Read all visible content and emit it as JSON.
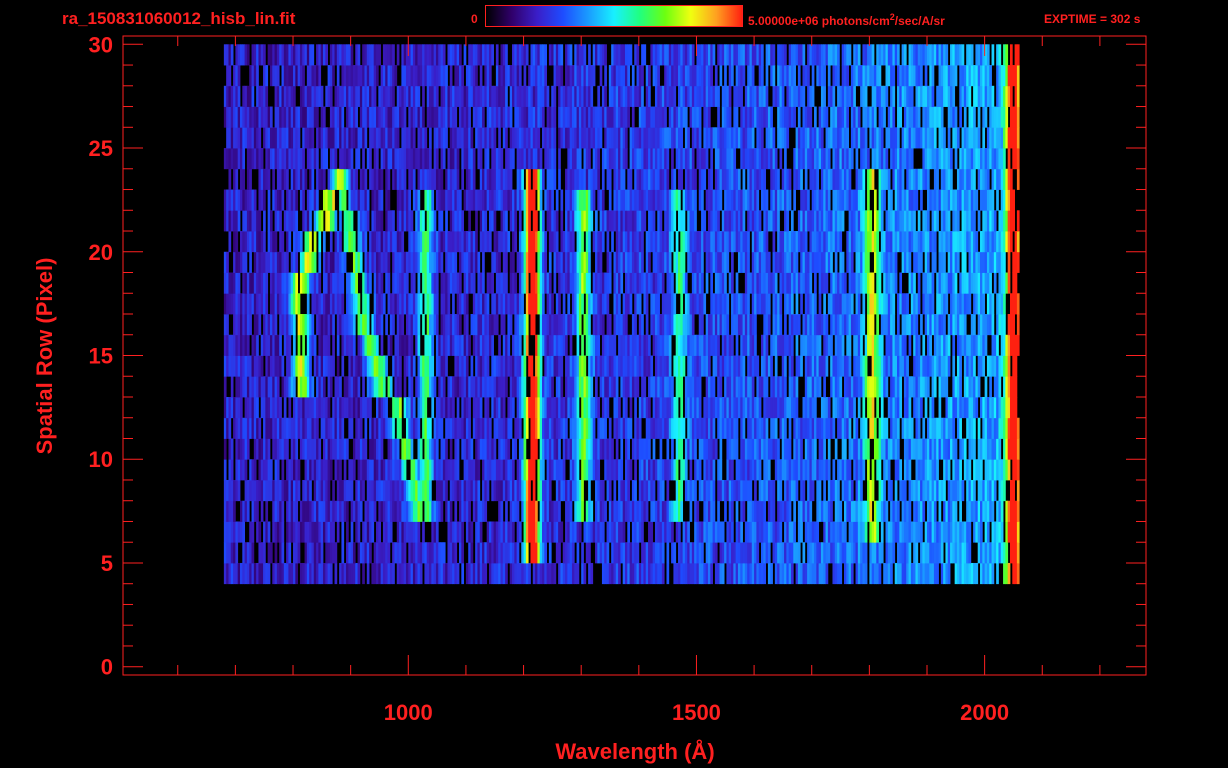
{
  "header": {
    "title": "ra_150831060012_hisb_lin.fit",
    "colorbar_min_label": "0",
    "colorbar_max_label": "5.00000e+06 photons/cm",
    "colorbar_max_sup": "2",
    "colorbar_max_suffix": "/sec/A/sr",
    "exptime_label": "EXPTIME = 302 s"
  },
  "colors": {
    "axis": "#ff2020",
    "background": "#000000",
    "colormap": [
      "#000000",
      "#30006a",
      "#3a1ec8",
      "#1e4cff",
      "#1a9cff",
      "#18f0ff",
      "#20ff80",
      "#6cff10",
      "#f0ff10",
      "#ffa020",
      "#ff2010"
    ]
  },
  "chart_data": {
    "type": "heatmap",
    "title": "ra_150831060012_hisb_lin.fit",
    "xlabel": "Wavelength (Å)",
    "ylabel": "Spatial Row (Pixel)",
    "xlim": [
      505,
      2280
    ],
    "ylim": [
      -0.4,
      30.4
    ],
    "xticks": [
      1000,
      1500,
      2000
    ],
    "xtick_labels": [
      "1000",
      "1500",
      "2000"
    ],
    "yticks": [
      0,
      5,
      10,
      15,
      20,
      25,
      30
    ],
    "ytick_labels": [
      "0",
      "5",
      "10",
      "15",
      "20",
      "25",
      "30"
    ],
    "colorbar_range": [
      0,
      5000000
    ],
    "colorbar_unit": "photons/cm^2/sec/A/sr",
    "grid": false,
    "data_extent": {
      "x": [
        680,
        2060
      ],
      "y": [
        4,
        30
      ]
    },
    "bright_features": [
      {
        "kind": "vertical_line",
        "x": 1215,
        "y_range": [
          5,
          24
        ],
        "intensity": 1.0
      },
      {
        "kind": "vertical_line",
        "x": 1304,
        "y_range": [
          7,
          23
        ],
        "intensity": 0.45
      },
      {
        "kind": "vertical_line",
        "x": 1030,
        "y_range": [
          7,
          23
        ],
        "intensity": 0.4
      },
      {
        "kind": "vertical_line",
        "x": 1470,
        "y_range": [
          7,
          23
        ],
        "intensity": 0.3
      },
      {
        "kind": "vertical_line",
        "x": 1805,
        "y_range": [
          6,
          24
        ],
        "intensity": 0.45
      },
      {
        "kind": "vertical_line",
        "x": 2050,
        "y_range": [
          3,
          30
        ],
        "intensity": 0.75
      },
      {
        "kind": "letter_stroke",
        "points": [
          [
            815,
            14
          ],
          [
            810,
            18
          ],
          [
            830,
            20
          ],
          [
            860,
            22
          ],
          [
            880,
            23
          ]
        ],
        "intensity": 0.55
      },
      {
        "kind": "letter_stroke",
        "points": [
          [
            880,
            23
          ],
          [
            900,
            21
          ],
          [
            920,
            17
          ],
          [
            950,
            14
          ],
          [
            985,
            12
          ],
          [
            1015,
            8
          ]
        ],
        "intensity": 0.45
      }
    ]
  }
}
